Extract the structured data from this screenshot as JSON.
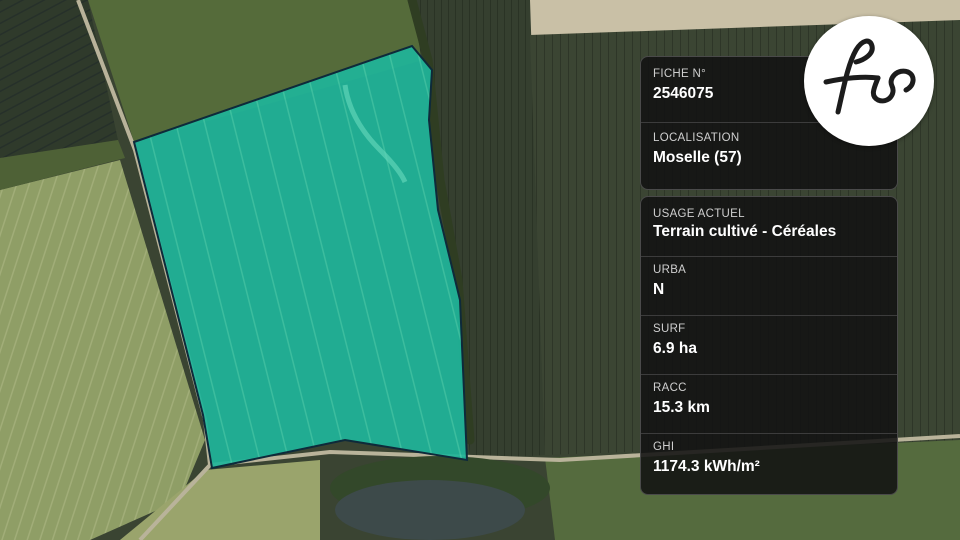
{
  "brand": {
    "logo_icon": "fs-monogram-logo",
    "logo_text": "fs"
  },
  "map": {
    "parcel_color": "#1fb59a",
    "parcel_outline": "#0e2a3a",
    "imagery": "satellite"
  },
  "card_top": {
    "fields": [
      {
        "label": "FICHE N°",
        "value": "2546075"
      },
      {
        "label": "LOCALISATION",
        "value": "Moselle (57)"
      }
    ]
  },
  "card_bottom": {
    "fields": [
      {
        "label": "USAGE ACTUEL",
        "value": "Terrain cultivé - Céréales"
      },
      {
        "label": "URBA",
        "value": "N"
      },
      {
        "label": "SURF",
        "value": "6.9 ha"
      },
      {
        "label": "RACC",
        "value": "15.3 km"
      },
      {
        "label": "GHI",
        "value": "1174.3 kWh/m²"
      }
    ]
  }
}
